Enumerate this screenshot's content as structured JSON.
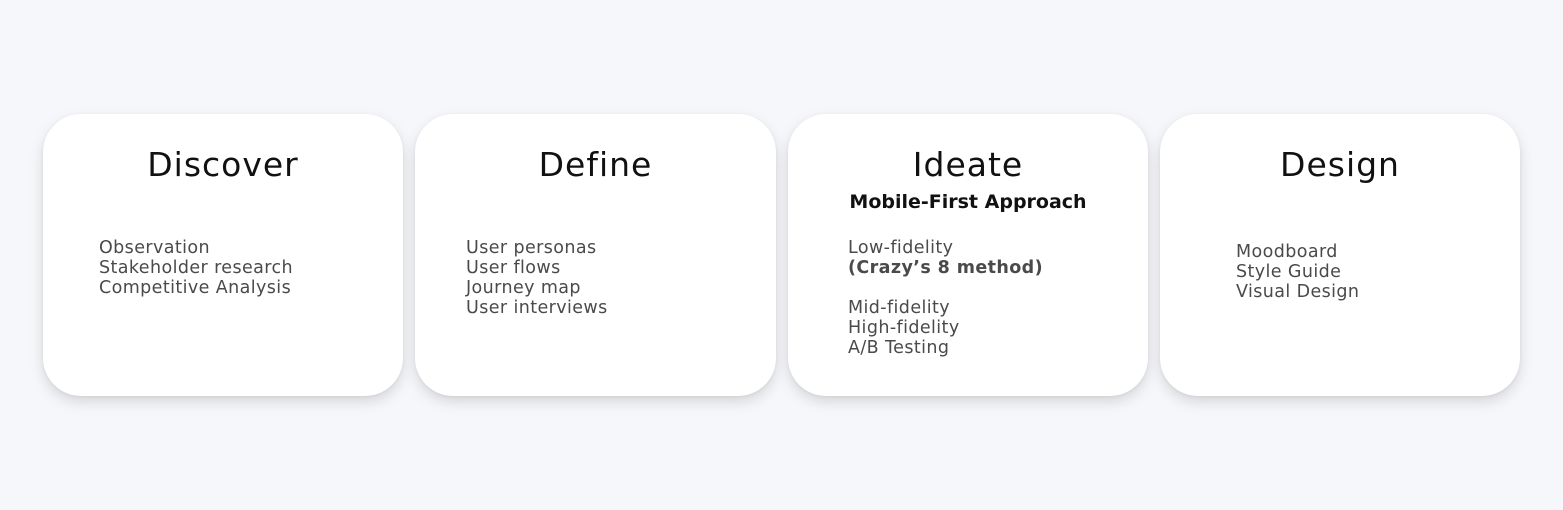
{
  "colors": {
    "background": "#f6f7fa",
    "card": "#ffffff",
    "title_text": "#111111",
    "item_text": "#4a4a4a"
  },
  "stages": [
    {
      "title": "Discover",
      "subtitle": "",
      "items": [
        "Observation",
        "Stakeholder research",
        "Competitive Analysis"
      ]
    },
    {
      "title": "Define",
      "subtitle": "",
      "items": [
        "User personas",
        "User flows",
        "Journey map",
        "User interviews"
      ]
    },
    {
      "title": "Ideate",
      "subtitle": "Mobile-First Approach",
      "items": [
        "Low-fidelity",
        "(Crazy’s 8 method)",
        "",
        "Mid-fidelity",
        "High-fidelity",
        "A/B Testing"
      ]
    },
    {
      "title": "Design",
      "subtitle": "",
      "items": [
        "Moodboard",
        "Style Guide",
        "Visual Design"
      ]
    }
  ]
}
